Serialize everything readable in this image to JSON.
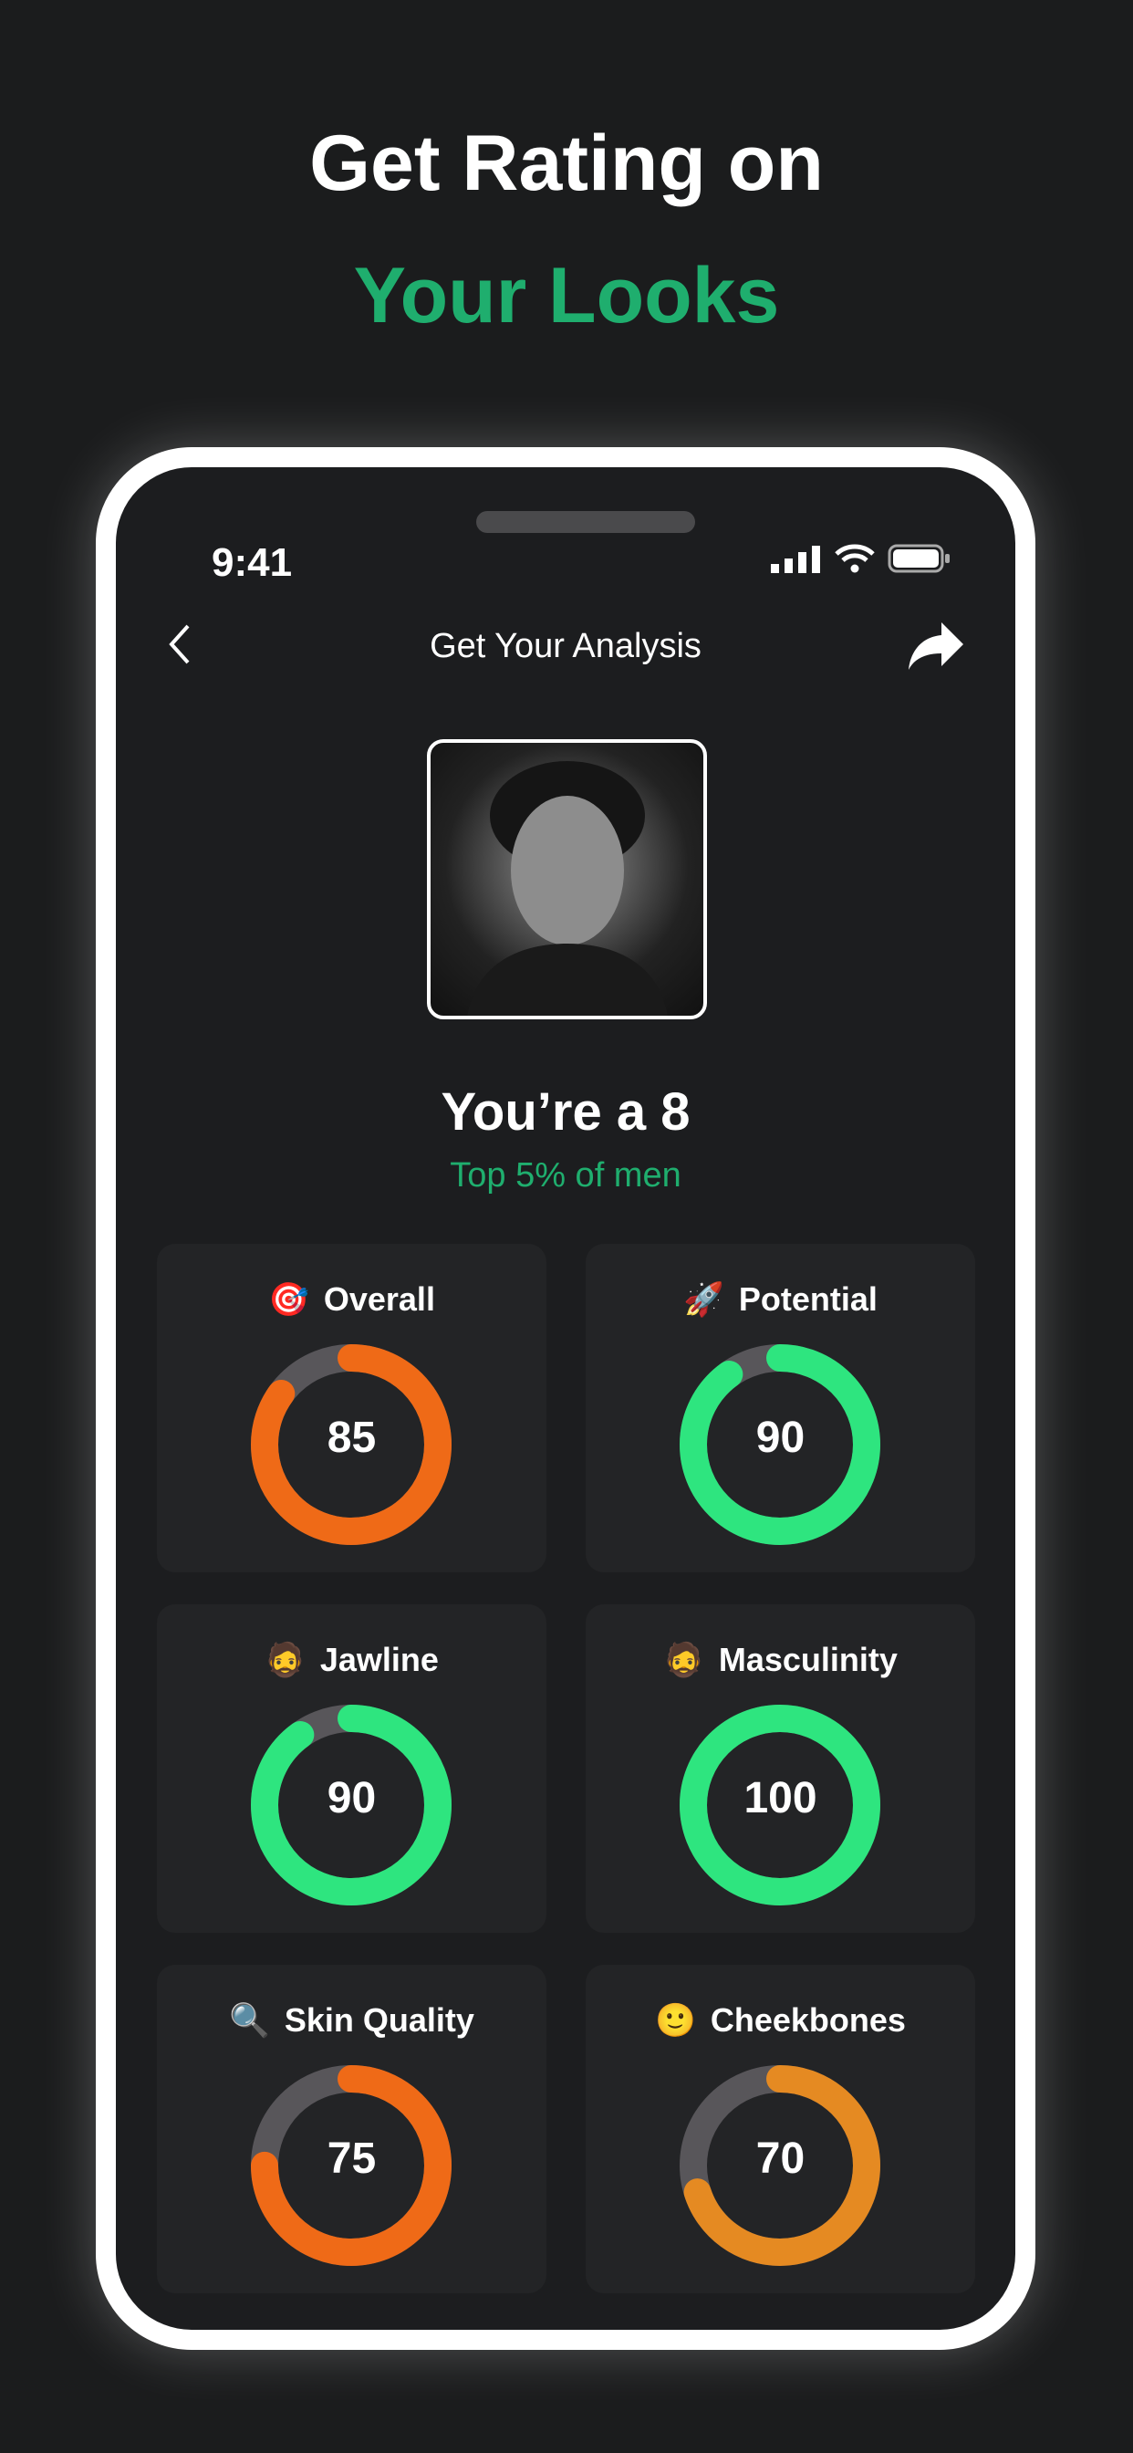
{
  "headline": {
    "line1": "Get Rating on",
    "line2": "Your Looks",
    "accent": "#1fae6e"
  },
  "status_bar": {
    "time": "9:41"
  },
  "nav": {
    "title": "Get Your Analysis",
    "back_icon": "chevron-left-icon",
    "share_icon": "share-arrow-icon"
  },
  "result": {
    "score_text": "You’re a 8",
    "percentile_text": "Top 5% of men"
  },
  "metrics": [
    {
      "label": "Overall",
      "value": 85,
      "icon": "🎯",
      "color": "#ef6a17"
    },
    {
      "label": "Potential",
      "value": 90,
      "icon": "🚀",
      "color": "#2ee57f"
    },
    {
      "label": "Jawline",
      "value": 90,
      "icon": "🧔",
      "color": "#2ee57f"
    },
    {
      "label": "Masculinity",
      "value": 100,
      "icon": "🧔",
      "color": "#2ee57f"
    },
    {
      "label": "Skin Quality",
      "value": 75,
      "icon": "🔍",
      "color": "#ef6a17"
    },
    {
      "label": "Cheekbones",
      "value": 70,
      "icon": "🙂",
      "color": "#e58a22"
    }
  ],
  "ring_track_color": "#58565a"
}
